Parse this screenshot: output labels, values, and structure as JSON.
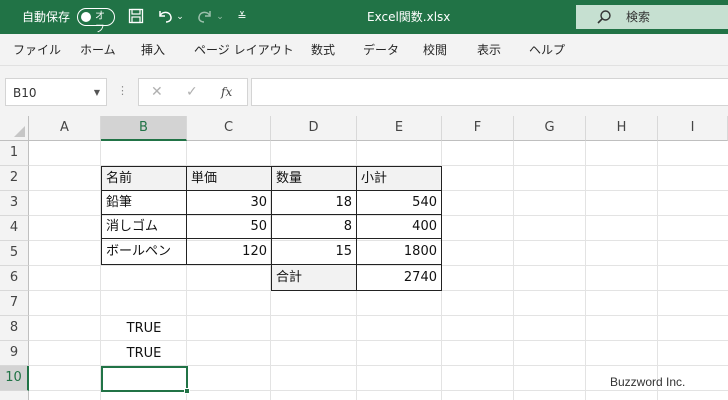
{
  "titlebar": {
    "autosave_label": "自動保存",
    "autosave_state": "オフ",
    "title": "Excel関数.xlsx",
    "search_label": "検索",
    "icons": [
      "save-icon",
      "undo-icon",
      "redo-icon",
      "customize-qat-icon",
      "search-icon"
    ]
  },
  "menu": {
    "items": [
      "ファイル",
      "ホーム",
      "挿入",
      "ページ レイアウト",
      "数式",
      "データ",
      "校閲",
      "表示",
      "ヘルプ"
    ]
  },
  "formula_bar": {
    "name_box": "B10",
    "cancel_symbol": "✕",
    "enter_symbol": "✓",
    "fx_label": "fx",
    "formula": ""
  },
  "sheet": {
    "columns": [
      "A",
      "B",
      "C",
      "D",
      "E",
      "F",
      "G",
      "H",
      "I"
    ],
    "rows": [
      "1",
      "2",
      "3",
      "4",
      "5",
      "6",
      "7",
      "8",
      "9",
      "10"
    ],
    "selected_cell": "B10",
    "cells": {
      "B2": "名前",
      "C2": "単価",
      "D2": "数量",
      "E2": "小計",
      "B3": "鉛筆",
      "C3": "30",
      "D3": "18",
      "E3": "540",
      "B4": "消しゴム",
      "C4": "50",
      "D4": "8",
      "E4": "400",
      "B5": "ボールペン",
      "C5": "120",
      "D5": "15",
      "E5": "1800",
      "D6": "合計",
      "E6": "2740",
      "B8": "TRUE",
      "B9": "TRUE"
    }
  },
  "watermark": "Buzzword Inc.",
  "colors": {
    "accent": "#217346",
    "header_fill": "#f2f2f2",
    "search_fill": "#c6e0d1"
  }
}
